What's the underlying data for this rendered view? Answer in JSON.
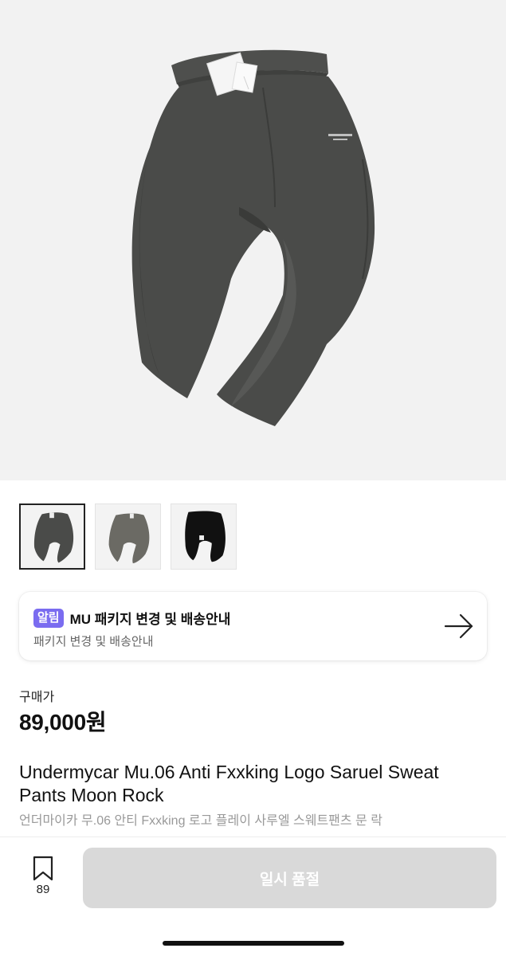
{
  "product": {
    "image_alt": "Undermycar Mu.06 Anti Fxxking Logo Saruel Sweat Pants Moon Rock",
    "thumbnails": [
      "moon-rock",
      "brown",
      "black"
    ],
    "selected_thumbnail": 0
  },
  "notice": {
    "badge": "알림",
    "title": "MU 패키지 변경 및 배송안내",
    "subtitle": "패키지 변경 및 배송안내",
    "arrow_icon": "arrow-right-icon"
  },
  "price": {
    "label": "구매가",
    "value": "89,000원"
  },
  "title": {
    "name": "Undermycar Mu.06 Anti Fxxking Logo Saruel Sweat Pants Moon Rock",
    "korean_name": "언더마이카 무.06 안티 Fxxking 로고 플레이 사루엘 스웨트팬츠 문 락"
  },
  "bottom_bar": {
    "bookmark_icon": "bookmark-icon",
    "bookmark_count": "89",
    "action_label": "일시 품절"
  },
  "colors": {
    "badge": "#7a6cf0",
    "pants_moon_rock": "#4a4b49",
    "button_disabled": "#d9d9d9"
  }
}
